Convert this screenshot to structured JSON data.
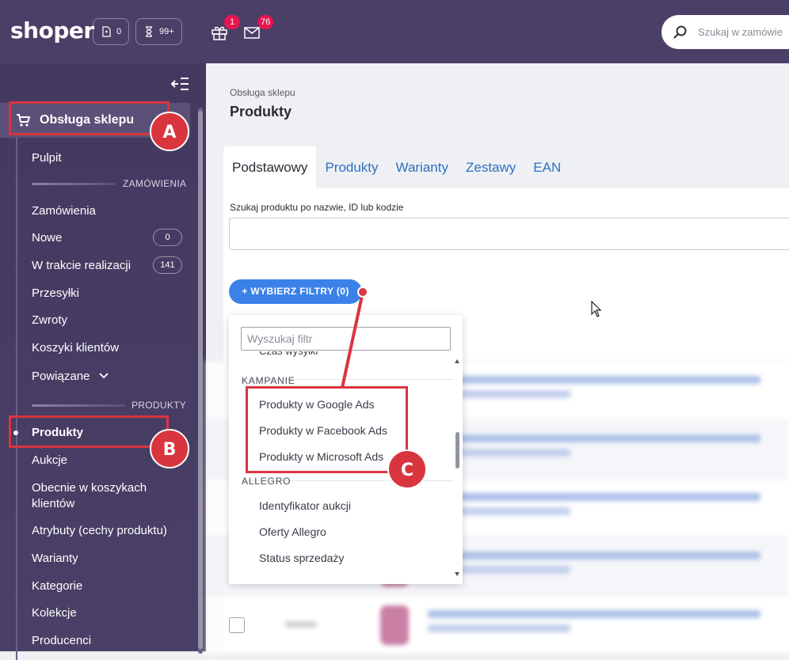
{
  "topbar": {
    "logo": "shoper",
    "pill_docs_count": "0",
    "pill_hourglass_count": "99+",
    "gift_badge": "1",
    "mail_badge": "76",
    "search_placeholder": "Szukaj w zamówie"
  },
  "sidebar": {
    "section_title": "Obsługa sklepu",
    "items": [
      {
        "label": "Pulpit"
      },
      {
        "label": "Zamówienia"
      },
      {
        "label": "Nowe",
        "count": "0"
      },
      {
        "label": "W trakcie realizacji",
        "count": "141"
      },
      {
        "label": "Przesyłki"
      },
      {
        "label": "Zwroty"
      },
      {
        "label": "Koszyki klientów"
      },
      {
        "label": "Powiązane"
      },
      {
        "label": "Produkty"
      },
      {
        "label": "Aukcje"
      },
      {
        "label": "Obecnie w koszykach klientów"
      },
      {
        "label": "Atrybuty (cechy produktu)"
      },
      {
        "label": "Warianty"
      },
      {
        "label": "Kategorie"
      },
      {
        "label": "Kolekcje"
      },
      {
        "label": "Producenci"
      }
    ],
    "group_orders": "ZAMÓWIENIA",
    "group_products": "PRODUKTY"
  },
  "main": {
    "breadcrumb": "Obsługa sklepu",
    "title": "Produkty",
    "tabs": [
      "Podstawowy",
      "Produkty",
      "Warianty",
      "Zestawy",
      "EAN"
    ],
    "search_label": "Szukaj produktu po nazwie, ID lub kodzie",
    "filter_button": "+ WYBIERZ FILTRY (0)"
  },
  "dropdown": {
    "search_placeholder": "Wyszukaj filtr",
    "cut_item": "Czas wysyłki",
    "section_kampanie": "KAMPANIE",
    "kampanie_items": [
      "Produkty w Google Ads",
      "Produkty w Facebook Ads",
      "Produkty w Microsoft Ads"
    ],
    "section_allegro": "ALLEGRO",
    "allegro_items": [
      "Identyfikator aukcji",
      "Oferty Allegro",
      "Status sprzedaży"
    ]
  },
  "annotations": {
    "a": "A",
    "b": "B",
    "c": "C",
    "color": "#d9353f"
  }
}
